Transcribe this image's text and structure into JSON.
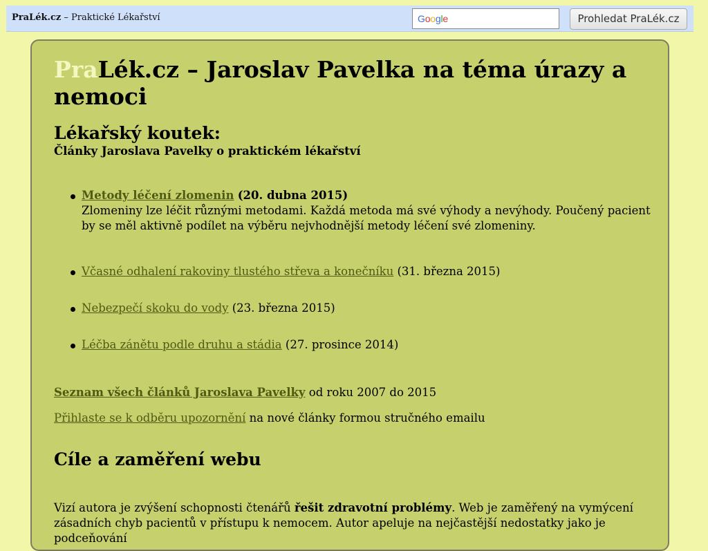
{
  "topbar": {
    "site_bold": "PraLék.cz",
    "site_rest": " – Praktické Lékařství",
    "search_placeholder": "",
    "google_logo": "Google",
    "search_button": "Prohledat PraLék.cz"
  },
  "main": {
    "title_pra": "Pra",
    "title_rest": "Lék.cz – Jaroslav Pavelka na téma úrazy a nemoci",
    "section_head": "Lékařský koutek:",
    "section_sub": "Články Jaroslava Pavelky o praktickém lékařství",
    "articles": [
      {
        "link": "Metody léčení zlomenin",
        "date": "(20. dubna 2015)",
        "desc": "Zlomeniny lze léčit různými metodami. Každá metoda má své výhody a nevýhody. Poučený pacient by se měl aktivně podílet na výběru nejvhodnější metody léčení své zlomeniny."
      },
      {
        "link": "Včasné odhalení rakoviny tlustého střeva a konečníku",
        "date": "(31. března 2015)"
      },
      {
        "link": "Nebezpečí skoku do vody",
        "date": "(23. března 2015)"
      },
      {
        "link": "Léčba zánětu podle druhu a stádia",
        "date": "(27. prosince 2014)"
      }
    ],
    "all_articles_link": "Seznam všech článků Jaroslava Pavelky",
    "all_articles_rest": " od roku 2007 do 2015",
    "subscribe_link": "Přihlaste se k odběru upozornění",
    "subscribe_rest": " na nové články formou stručného emailu",
    "goals_head": "Cíle a zaměření webu",
    "vision_start": "Vizí autora je zvýšení schopnosti čtenářů ",
    "vision_bold": "řešit zdravotní problémy",
    "vision_rest": ". Web je zaměřený na vymýcení zásadních chyb pacientů v přístupu k nemocem. Autor apeluje na nejčastější nedostatky jako je podceňování"
  },
  "colors": {
    "page_bg": "#f2f6a8",
    "panel_bg": "#c6d06c",
    "topbar_bg": "#cfe0fb",
    "link": "#4f5a12",
    "title_accent": "#f5f7c0"
  }
}
